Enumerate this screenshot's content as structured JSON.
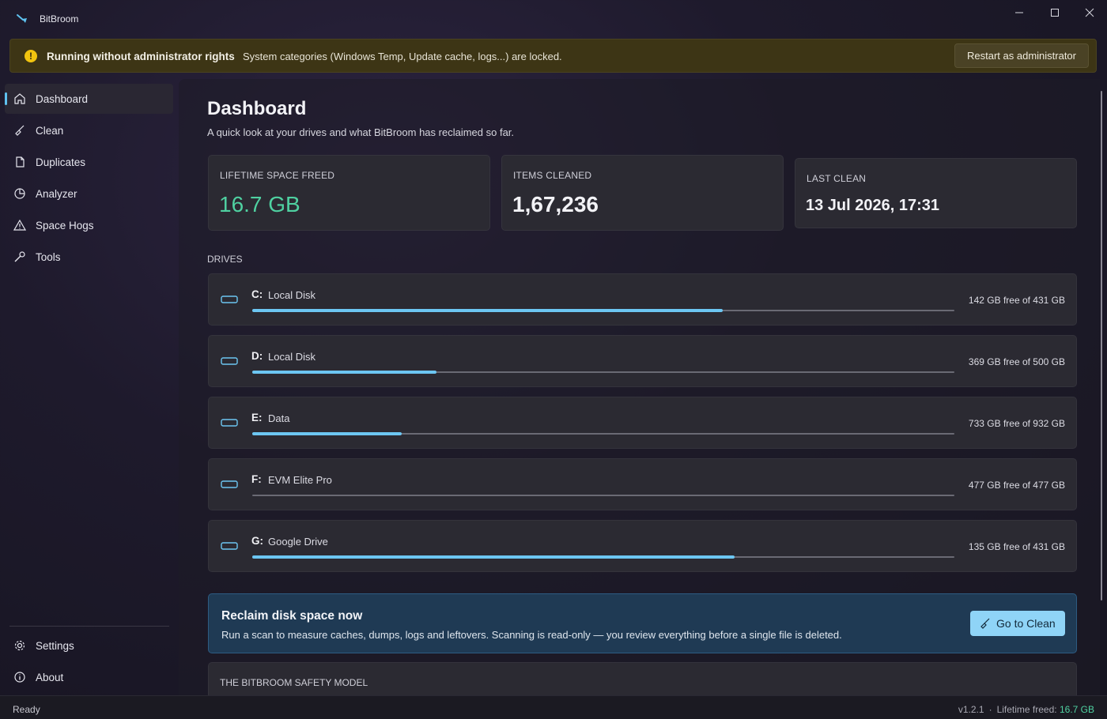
{
  "window": {
    "title": "BitBroom"
  },
  "banner": {
    "title": "Running without administrator rights",
    "message": "System categories (Windows Temp, Update cache, logs...) are locked.",
    "button_label": "Restart as administrator",
    "color": "#3d3515"
  },
  "sidebar": {
    "items": [
      {
        "label": "Dashboard",
        "icon": "home-icon",
        "active": true
      },
      {
        "label": "Clean",
        "icon": "broom-icon"
      },
      {
        "label": "Duplicates",
        "icon": "document-icon"
      },
      {
        "label": "Analyzer",
        "icon": "pie-chart-icon"
      },
      {
        "label": "Space Hogs",
        "icon": "warning-icon"
      },
      {
        "label": "Tools",
        "icon": "wrench-icon"
      }
    ],
    "footer_items": [
      {
        "label": "Settings",
        "icon": "gear-icon"
      },
      {
        "label": "About",
        "icon": "info-icon"
      }
    ]
  },
  "main": {
    "title": "Dashboard",
    "subtitle": "A quick look at your drives and what BitBroom has reclaimed so far.",
    "stats": [
      {
        "label": "LIFETIME SPACE FREED",
        "value": "16.7 GB"
      },
      {
        "label": "ITEMS CLEANED",
        "value": "1,67,236"
      },
      {
        "label": "LAST CLEAN",
        "value": "13 Jul 2026, 17:31"
      }
    ],
    "drives_label": "DRIVES",
    "drives": [
      {
        "letter": "C:",
        "name": "Local Disk",
        "free_text": "142 GB free of 431 GB",
        "used_fraction": 0.67
      },
      {
        "letter": "D:",
        "name": "Local Disk",
        "free_text": "369 GB free of 500 GB",
        "used_fraction": 0.262
      },
      {
        "letter": "E:",
        "name": "Data",
        "free_text": "733 GB free of 932 GB",
        "used_fraction": 0.213
      },
      {
        "letter": "F:",
        "name": "EVM Elite Pro",
        "free_text": "477 GB free of 477 GB",
        "used_fraction": 0.0
      },
      {
        "letter": "G:",
        "name": "Google Drive",
        "free_text": "135 GB free of 431 GB",
        "used_fraction": 0.687
      }
    ],
    "cta": {
      "title": "Reclaim disk space now",
      "text": "Run a scan to measure caches, dumps, logs and leftovers. Scanning is read-only — you review everything before a single file is deleted.",
      "button_label": "Go to Clean"
    },
    "safety_title": "THE BITBROOM SAFETY MODEL"
  },
  "status": {
    "left": "Ready",
    "version": "v1.2.1",
    "separator": "·",
    "lifetime_label": "Lifetime freed:",
    "lifetime_value": "16.7 GB"
  },
  "colors": {
    "accent": "#6cc6f2",
    "success": "#4fd1a1",
    "warning": "#f1c40f"
  }
}
